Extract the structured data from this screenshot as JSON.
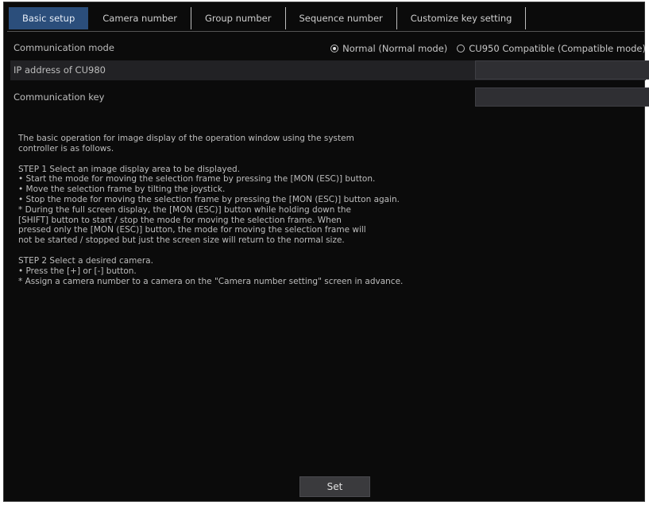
{
  "tabs": [
    {
      "label": "Basic setup"
    },
    {
      "label": "Camera number"
    },
    {
      "label": "Group number"
    },
    {
      "label": "Sequence number"
    },
    {
      "label": "Customize key setting"
    }
  ],
  "settings": {
    "communication_mode": {
      "label": "Communication mode",
      "options": [
        {
          "label": "Normal (Normal mode)",
          "selected": true
        },
        {
          "label": "CU950 Compatible (Compatible mode)",
          "selected": false
        }
      ]
    },
    "ip_address": {
      "label": "IP address of CU980",
      "value": ""
    },
    "communication_key": {
      "label": "Communication key",
      "value": ""
    }
  },
  "description": {
    "intro": [
      "The basic operation for image display of the operation window using the system",
      "controller is as follows."
    ],
    "step1": [
      "STEP 1 Select an image display area to be displayed.",
      "• Start the mode for moving the selection frame by pressing the [MON (ESC)] button.",
      "• Move the selection frame by tilting the joystick.",
      "• Stop the mode for moving the selection frame by pressing the [MON (ESC)] button again.",
      "* During the full screen display, the [MON (ESC)] button while holding down the",
      "[SHIFT] button to start / stop the mode for moving the selection frame. When",
      "pressed only the [MON (ESC)] button, the mode for moving the selection frame will",
      "not be started / stopped but just the screen size will return to the normal size."
    ],
    "step2": [
      "STEP 2 Select a desired camera.",
      "• Press the [+] or [-] button.",
      "* Assign a camera number to a camera on the \"Camera number setting\" screen in advance."
    ]
  },
  "buttons": {
    "set_label": "Set"
  }
}
